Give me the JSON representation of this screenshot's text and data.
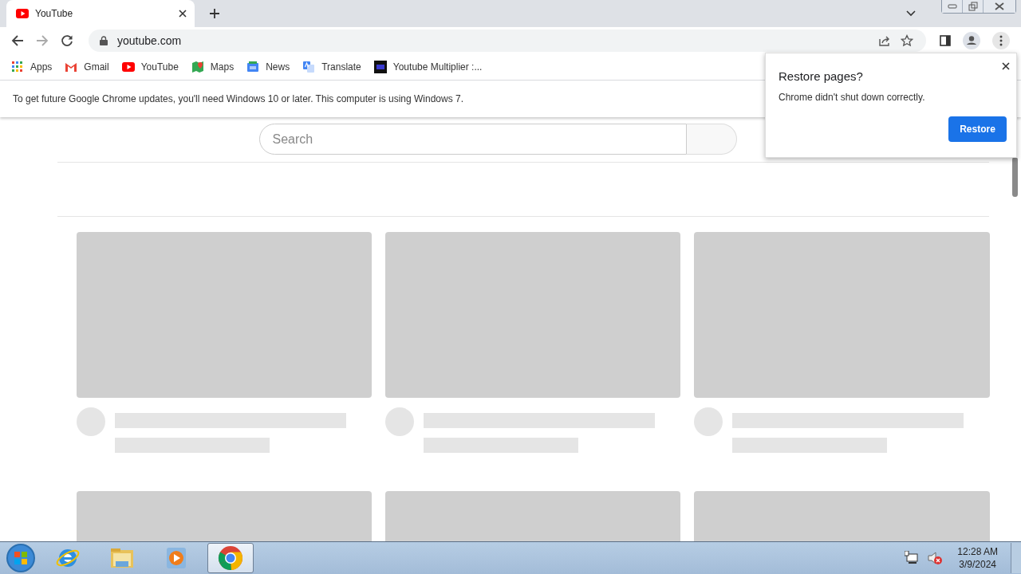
{
  "tabs": [
    {
      "title": "YouTube",
      "selected": true
    }
  ],
  "toolbar": {
    "address": "youtube.com"
  },
  "bookmarks": [
    {
      "label": "Apps",
      "kind": "apps"
    },
    {
      "label": "Gmail",
      "kind": "gmail"
    },
    {
      "label": "YouTube",
      "kind": "youtube"
    },
    {
      "label": "Maps",
      "kind": "maps"
    },
    {
      "label": "News",
      "kind": "news"
    },
    {
      "label": "Translate",
      "kind": "translate"
    },
    {
      "label": "Youtube Multiplier :...",
      "kind": "ytm"
    }
  ],
  "info_bar": {
    "message": "To get future Google Chrome updates, you'll need Windows 10 or later. This computer is using Windows 7."
  },
  "page": {
    "search": {
      "placeholder": "Search"
    }
  },
  "restore_dialog": {
    "title": "Restore pages?",
    "message": "Chrome didn't shut down correctly.",
    "button": "Restore"
  },
  "taskbar": {
    "apps": [
      {
        "kind": "ie",
        "selected": false
      },
      {
        "kind": "explorer",
        "selected": false
      },
      {
        "kind": "media",
        "selected": false
      },
      {
        "kind": "chrome",
        "selected": true
      }
    ],
    "time": "12:28 AM",
    "date": "3/9/2024"
  }
}
